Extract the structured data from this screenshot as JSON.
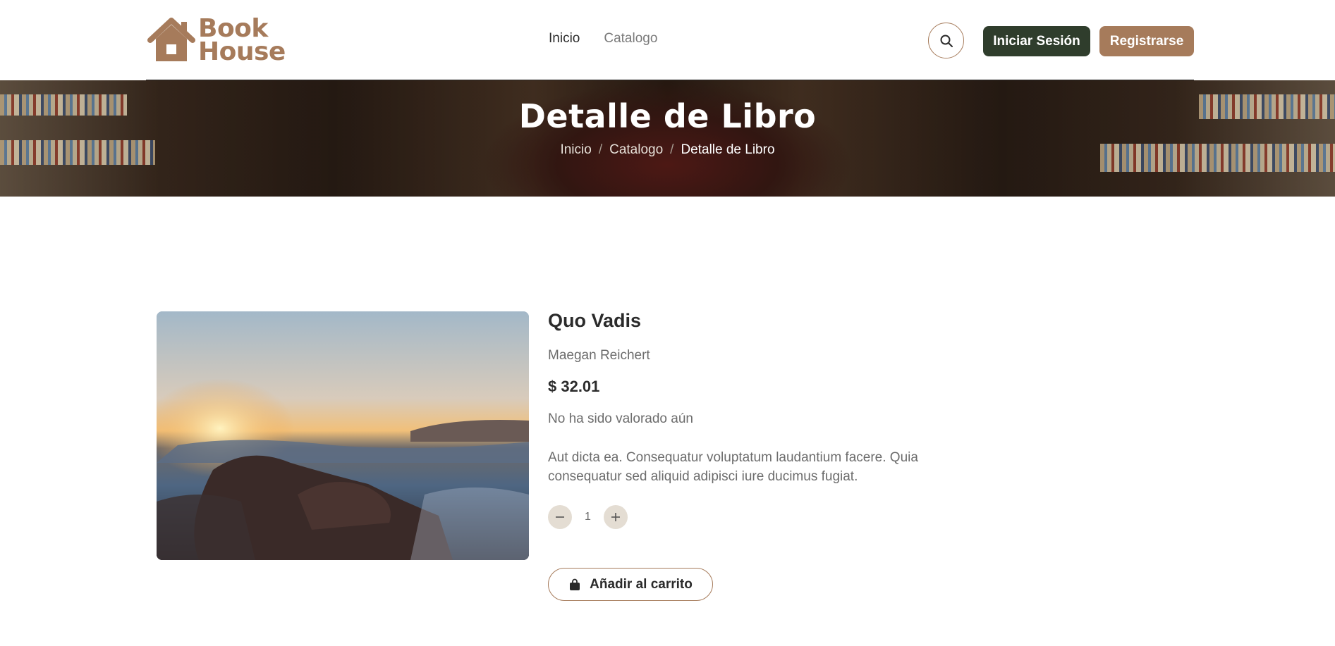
{
  "header": {
    "logo": {
      "line1": "Book",
      "line2": "House"
    },
    "nav": [
      {
        "label": "Inicio"
      },
      {
        "label": "Catalogo"
      }
    ],
    "search_icon": "search-icon",
    "login_label": "Iniciar Sesión",
    "register_label": "Registrarse"
  },
  "hero": {
    "title": "Detalle de Libro",
    "breadcrumb": [
      "Inicio",
      "Catalogo",
      "Detalle de Libro"
    ],
    "separator": "/"
  },
  "product": {
    "title": "Quo Vadis",
    "author": "Maegan Reichert",
    "price": "$ 32.01",
    "rating_text": "No ha sido valorado aún",
    "description": "Aut dicta ea. Consequatur voluptatum laudantium facere. Quia consequatur sed aliquid adipisci iure ducimus fugiat.",
    "quantity": "1",
    "add_to_cart_label": "Añadir al carrito"
  },
  "colors": {
    "brand": "#a67b5b",
    "dark_green": "#2f3d2c",
    "qty_button_bg": "#e4ddd3"
  }
}
